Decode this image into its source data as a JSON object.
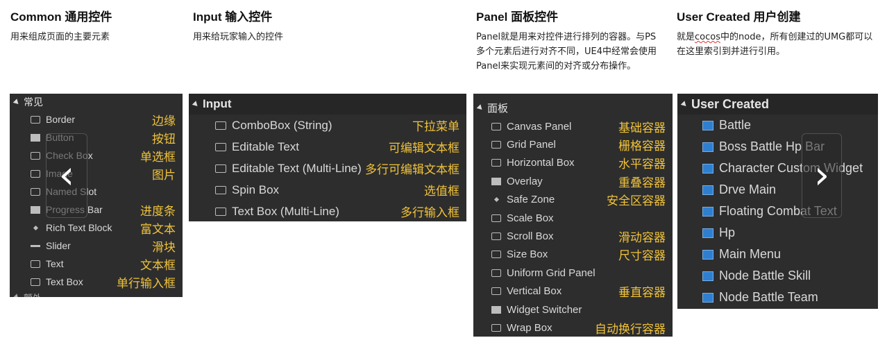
{
  "columns": [
    {
      "title": "Common 通用控件",
      "desc": "用来组成页面的主要元素"
    },
    {
      "title": "Input 输入控件",
      "desc": "用来给玩家输入的控件"
    },
    {
      "title": "Panel 面板控件",
      "desc": "Panel就是用来对控件进行排列的容器。与PS多个元素后进行对齐不同，UE4中经常会使用Panel来实现元素间的对齐或分布操作。"
    },
    {
      "title": "User Created 用户创建",
      "desc_pre": "就是",
      "desc_wavy": "cocos",
      "desc_post": "中的node，所有创建过的UMG都可以在这里索引到并进行引用。"
    }
  ],
  "common_panel": {
    "header": "常见",
    "items": [
      {
        "label": "Border",
        "anno": "边缘",
        "icon": "border-icon"
      },
      {
        "label": "Button",
        "anno": "按钮",
        "icon": "button-icon"
      },
      {
        "label": "Check Box",
        "anno": "单选框",
        "icon": "checkbox-icon"
      },
      {
        "label": "Image",
        "anno": "图片",
        "icon": "image-icon"
      },
      {
        "label": "Named Slot",
        "anno": "",
        "icon": "named-slot-icon"
      },
      {
        "label": "Progress Bar",
        "anno": "进度条",
        "icon": "progress-bar-icon"
      },
      {
        "label": "Rich Text Block",
        "anno": "富文本",
        "icon": "rich-text-icon"
      },
      {
        "label": "Slider",
        "anno": "滑块",
        "icon": "slider-icon"
      },
      {
        "label": "Text",
        "anno": "文本框",
        "icon": "text-icon"
      },
      {
        "label": "Text Box",
        "anno": "单行输入框",
        "icon": "text-box-icon"
      }
    ],
    "next_header": "额外"
  },
  "input_panel": {
    "header": "Input",
    "items": [
      {
        "label": "ComboBox (String)",
        "anno": "下拉菜单",
        "icon": "combobox-icon"
      },
      {
        "label": "Editable Text",
        "anno": "可编辑文本框",
        "icon": "editable-text-icon"
      },
      {
        "label": "Editable Text (Multi-Line)",
        "anno": "多行可编辑文本框",
        "icon": "editable-text-multiline-icon"
      },
      {
        "label": "Spin Box",
        "anno": "选值框",
        "icon": "spin-box-icon"
      },
      {
        "label": "Text Box (Multi-Line)",
        "anno": "多行输入框",
        "icon": "text-box-multiline-icon"
      }
    ]
  },
  "panel_panel": {
    "header": "面板",
    "items": [
      {
        "label": "Canvas Panel",
        "anno": "基础容器",
        "icon": "canvas-panel-icon"
      },
      {
        "label": "Grid Panel",
        "anno": "栅格容器",
        "icon": "grid-panel-icon"
      },
      {
        "label": "Horizontal Box",
        "anno": "水平容器",
        "icon": "horizontal-box-icon"
      },
      {
        "label": "Overlay",
        "anno": "重叠容器",
        "icon": "overlay-icon"
      },
      {
        "label": "Safe Zone",
        "anno": "安全区容器",
        "icon": "safe-zone-icon"
      },
      {
        "label": "Scale Box",
        "anno": "",
        "icon": "scale-box-icon"
      },
      {
        "label": "Scroll Box",
        "anno": "滑动容器",
        "icon": "scroll-box-icon"
      },
      {
        "label": "Size Box",
        "anno": "尺寸容器",
        "icon": "size-box-icon"
      },
      {
        "label": "Uniform Grid Panel",
        "anno": "",
        "icon": "uniform-grid-icon"
      },
      {
        "label": "Vertical Box",
        "anno": "垂直容器",
        "icon": "vertical-box-icon"
      },
      {
        "label": "Widget Switcher",
        "anno": "",
        "icon": "widget-switcher-icon"
      },
      {
        "label": "Wrap Box",
        "anno": "自动换行容器",
        "icon": "wrap-box-icon"
      }
    ]
  },
  "user_panel": {
    "header": "User Created",
    "items": [
      {
        "label": "Battle"
      },
      {
        "label": "Boss Battle Hp Bar"
      },
      {
        "label": "Character Custom Widget"
      },
      {
        "label": "Drve Main"
      },
      {
        "label": "Floating Combat Text"
      },
      {
        "label": "Hp"
      },
      {
        "label": "Main Menu"
      },
      {
        "label": "Node Battle Skill"
      },
      {
        "label": "Node Battle Team"
      }
    ]
  },
  "nav": {
    "prev": "‹",
    "next": "›"
  },
  "colors": {
    "panel_bg": "#2d2d2d",
    "annotation": "#f0c23a",
    "user_icon": "#2f7fd1"
  }
}
